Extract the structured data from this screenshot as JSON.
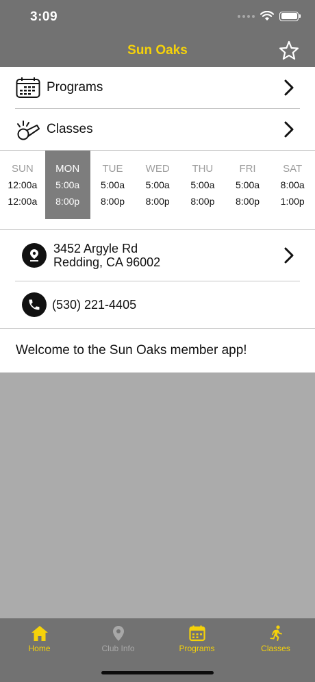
{
  "status": {
    "time": "3:09"
  },
  "nav": {
    "title": "Sun Oaks"
  },
  "menu": [
    {
      "label": "Programs"
    },
    {
      "label": "Classes"
    }
  ],
  "hours": {
    "days": [
      {
        "name": "SUN",
        "open": "12:00a",
        "close": "12:00a"
      },
      {
        "name": "MON",
        "open": "5:00a",
        "close": "8:00p"
      },
      {
        "name": "TUE",
        "open": "5:00a",
        "close": "8:00p"
      },
      {
        "name": "WED",
        "open": "5:00a",
        "close": "8:00p"
      },
      {
        "name": "THU",
        "open": "5:00a",
        "close": "8:00p"
      },
      {
        "name": "FRI",
        "open": "5:00a",
        "close": "8:00p"
      },
      {
        "name": "SAT",
        "open": "8:00a",
        "close": "1:00p"
      }
    ],
    "today_index": 1
  },
  "contact": {
    "address_line1": "3452 Argyle Rd",
    "address_line2": "Redding, CA 96002",
    "phone": "(530) 221-4405"
  },
  "welcome": "Welcome to the Sun Oaks member app!",
  "tabs": [
    {
      "label": "Home",
      "icon": "home-icon",
      "active": true
    },
    {
      "label": "Club Info",
      "icon": "location-pin-icon",
      "active": false
    },
    {
      "label": "Programs",
      "icon": "calendar-icon",
      "active": true
    },
    {
      "label": "Classes",
      "icon": "running-person-icon",
      "active": true
    }
  ],
  "colors": {
    "accent": "#f5d20a",
    "bar": "#727272",
    "background": "#ababab",
    "today_highlight": "#7d7d7d",
    "inactive_tab": "#a8a8a8"
  }
}
